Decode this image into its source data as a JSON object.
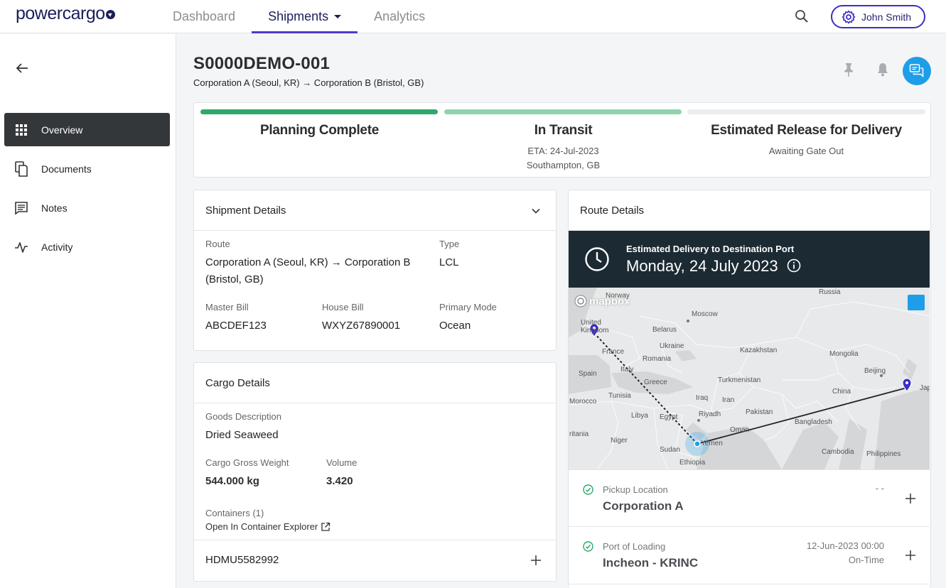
{
  "app": {
    "logo": "powercargo"
  },
  "nav": {
    "items": [
      "Dashboard",
      "Shipments",
      "Analytics"
    ]
  },
  "user": {
    "name": "John Smith"
  },
  "sidebar": {
    "items": [
      {
        "label": "Overview",
        "icon": "grid-icon"
      },
      {
        "label": "Documents",
        "icon": "documents-icon"
      },
      {
        "label": "Notes",
        "icon": "notes-icon"
      },
      {
        "label": "Activity",
        "icon": "activity-icon"
      }
    ]
  },
  "shipment": {
    "id": "S0000DEMO-001",
    "route": "Corporation A (Seoul, KR) → Corporation B (Bristol, GB)"
  },
  "progress": {
    "stages": [
      {
        "title": "Planning Complete",
        "line1": "",
        "line2": "",
        "color": "#2fa86a",
        "fill": 1
      },
      {
        "title": "In Transit",
        "line1": "ETA: 24-Jul-2023",
        "line2": "Southampton, GB",
        "color": "#8fd3ad",
        "fill": 1
      },
      {
        "title": "Estimated Release for Delivery",
        "line1": "Awaiting Gate Out",
        "line2": "",
        "color": "#ebedef",
        "fill": 0
      }
    ]
  },
  "shipment_details": {
    "title": "Shipment Details",
    "route_label": "Route",
    "route_value": "Corporation A (Seoul, KR) → Corporation B (Bristol, GB)",
    "type_label": "Type",
    "type_value": "LCL",
    "master_bill_label": "Master Bill",
    "master_bill_value": "ABCDEF123",
    "house_bill_label": "House Bill",
    "house_bill_value": "WXYZ67890001",
    "primary_mode_label": "Primary Mode",
    "primary_mode_value": "Ocean"
  },
  "cargo_details": {
    "title": "Cargo Details",
    "goods_label": "Goods Description",
    "goods_value": "Dried Seaweed",
    "weight_label": "Cargo Gross Weight",
    "weight_value": "544.000 kg",
    "volume_label": "Volume",
    "volume_value": "3.420",
    "containers_label": "Containers (1)",
    "explorer_link": "Open In Container Explorer",
    "container_id": "HDMU5582992"
  },
  "route_details": {
    "title": "Route Details",
    "eta_label": "Estimated Delivery to Destination Port",
    "eta_date": "Monday, 24 July 2023",
    "map": {
      "brand": "mapbox",
      "labels": [
        "Russia",
        "Norway",
        "Moscow",
        "United Kingdom",
        "Belarus",
        "Ukraine",
        "Kazakhstan",
        "Mongolia",
        "France",
        "Romania",
        "Italy",
        "Spain",
        "Greece",
        "Turkmenistan",
        "Beijing",
        "Tunisia",
        "Iraq",
        "Iran",
        "China",
        "Jap",
        "Morocco",
        "Riyadh",
        "Pakistan",
        "Libya",
        "Egypt",
        "Bangladesh",
        "Oman",
        "ritania",
        "Niger",
        "Yemen",
        "Sudan",
        "Cambodia",
        "Philippines",
        "Ethiopia"
      ]
    },
    "legs": [
      {
        "label": "Pickup Location",
        "value": "Corporation A",
        "date": "- -",
        "status": ""
      },
      {
        "label": "Port of Loading",
        "value": "Incheon - KRINC",
        "date": "12-Jun-2023 00:00",
        "status": "On-Time"
      }
    ]
  },
  "colors": {
    "brand": "#1b1e5c",
    "accent": "#4b3ccf",
    "chat": "#1e9ee8",
    "banner": "#1c2a33",
    "success": "#2fa86a"
  }
}
